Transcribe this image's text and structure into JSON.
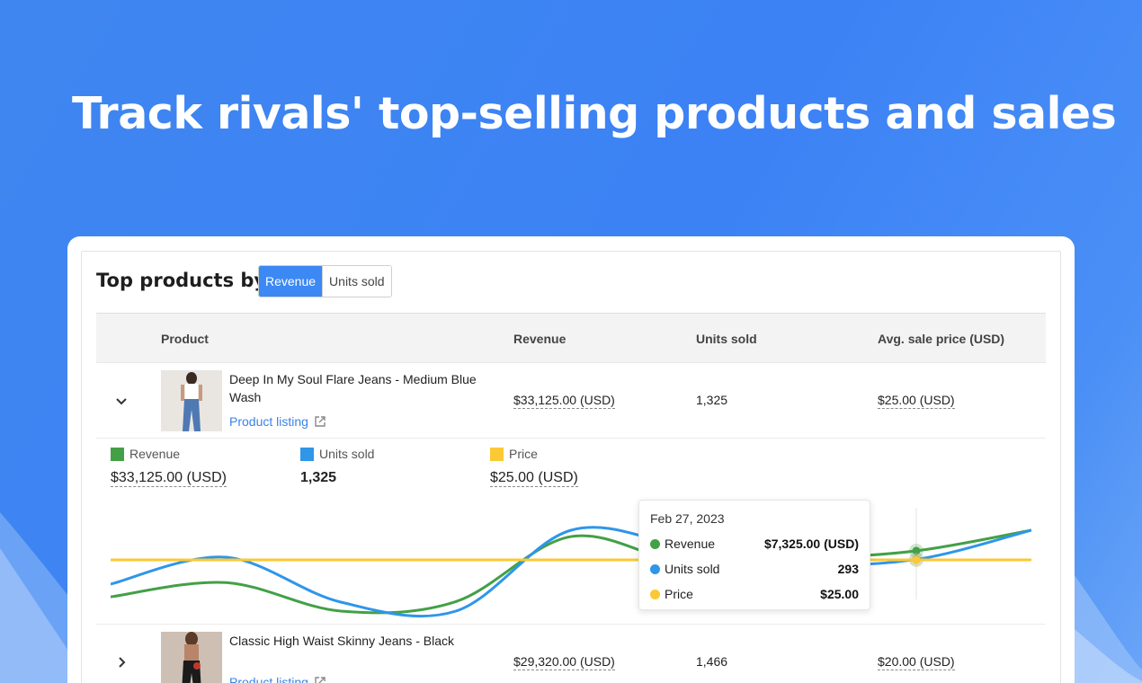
{
  "hero": {
    "title": "Track rivals' top-selling products and sales"
  },
  "panel": {
    "title": "Top products by",
    "toggle": [
      {
        "label": "Revenue",
        "active": true
      },
      {
        "label": "Units sold",
        "active": false
      }
    ]
  },
  "table": {
    "columns": {
      "product": "Product",
      "revenue": "Revenue",
      "units": "Units sold",
      "price": "Avg. sale price (USD)"
    },
    "rows": [
      {
        "name": "Deep In My Soul Flare Jeans - Medium Blue Wash",
        "link": "Product listing",
        "revenue": "$33,125.00 (USD)",
        "units": "1,325",
        "price": "$25.00 (USD)",
        "expanded": true
      },
      {
        "name": "Classic High Waist Skinny Jeans - Black",
        "link": "Product listing",
        "revenue": "$29,320.00 (USD)",
        "units": "1,466",
        "price": "$20.00 (USD)",
        "expanded": false
      }
    ]
  },
  "detail": {
    "legend": [
      {
        "label": "Revenue",
        "value": "$33,125.00 (USD)",
        "color": "#43a047"
      },
      {
        "label": "Units sold",
        "value": "1,325",
        "color": "#2f96e8"
      },
      {
        "label": "Price",
        "value": "$25.00 (USD)",
        "color": "#fbc934"
      }
    ],
    "tooltip": {
      "date": "Feb 27, 2023",
      "rows": [
        {
          "label": "Revenue",
          "value": "$7,325.00 (USD)",
          "color": "#43a047"
        },
        {
          "label": "Units sold",
          "value": "293",
          "color": "#2f96e8"
        },
        {
          "label": "Price",
          "value": "$25.00",
          "color": "#fbc934"
        }
      ]
    }
  },
  "chart_data": {
    "type": "line",
    "x_points": 9,
    "series": [
      {
        "name": "Revenue",
        "color": "#43a047",
        "values": [
          5200,
          6100,
          4300,
          4900,
          9000,
          7325,
          7600,
          8100,
          9400
        ]
      },
      {
        "name": "Units sold",
        "color": "#2f96e8",
        "values": [
          210,
          270,
          170,
          150,
          330,
          293,
          255,
          265,
          330
        ]
      },
      {
        "name": "Price",
        "color": "#fbc934",
        "values": [
          25,
          25,
          25,
          25,
          25,
          25,
          25,
          25,
          25
        ]
      }
    ]
  }
}
